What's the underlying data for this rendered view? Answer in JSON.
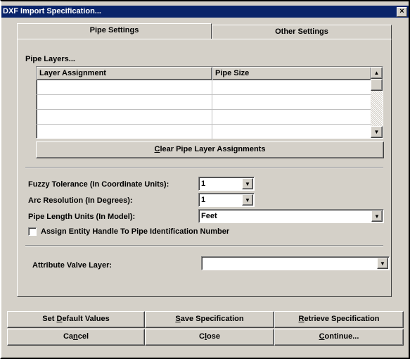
{
  "window": {
    "title": "DXF Import Specification...",
    "close_glyph": "×"
  },
  "tabs": [
    {
      "label": "Pipe Settings"
    },
    {
      "label": "Other Settings"
    }
  ],
  "pipe_layers": {
    "group_label": "Pipe Layers...",
    "columns": [
      "Layer Assignment",
      "Pipe Size"
    ],
    "rows": [
      [
        "",
        ""
      ],
      [
        "",
        ""
      ],
      [
        "",
        ""
      ],
      [
        "",
        ""
      ]
    ],
    "clear_button": {
      "pre": "",
      "accel": "C",
      "post": "lear Pipe Layer Assignments"
    }
  },
  "fields": {
    "fuzzy_tolerance": {
      "label": "Fuzzy Tolerance (In Coordinate Units):",
      "value": "1"
    },
    "arc_resolution": {
      "label": "Arc Resolution (In Degrees):",
      "value": "1"
    },
    "pipe_length_units": {
      "label": "Pipe Length Units (In Model):",
      "value": "Feet"
    },
    "assign_entity_handle": {
      "label": "Assign Entity Handle To Pipe Identification Number",
      "checked": false
    },
    "attribute_valve_layer": {
      "label": "Attribute Valve Layer:",
      "value": ""
    }
  },
  "buttons": {
    "set_default": {
      "pre": "Set ",
      "accel": "D",
      "post": "efault Values"
    },
    "save": {
      "pre": "",
      "accel": "S",
      "post": "ave Specification"
    },
    "retrieve": {
      "pre": "",
      "accel": "R",
      "post": "etrieve Specification"
    },
    "cancel": {
      "pre": "Ca",
      "accel": "n",
      "post": "cel"
    },
    "close": {
      "pre": "C",
      "accel": "l",
      "post": "ose"
    },
    "continue": {
      "pre": "",
      "accel": "C",
      "post": "ontinue..."
    }
  }
}
